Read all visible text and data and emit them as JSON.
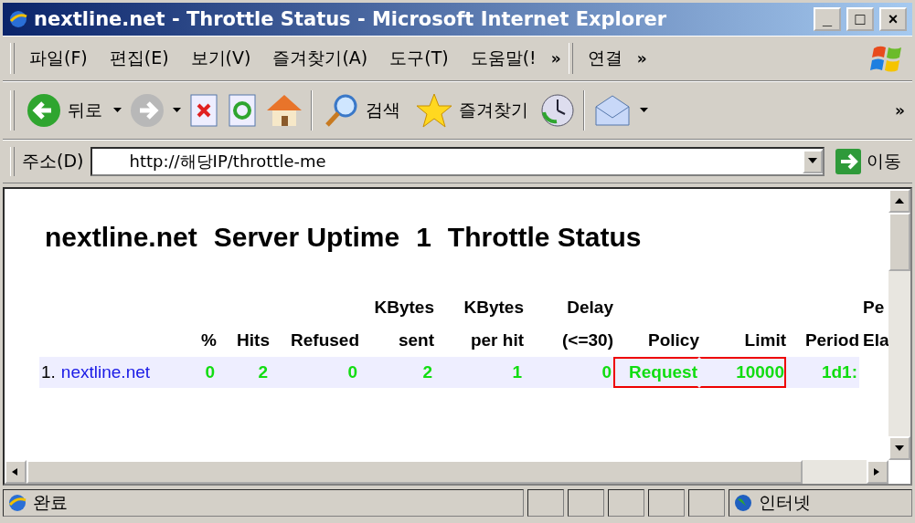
{
  "window": {
    "title": "nextline.net - Throttle Status - Microsoft Internet Explorer",
    "controls": [
      "_",
      "□",
      "×"
    ]
  },
  "menu": {
    "items": [
      "파일(F)",
      "편집(E)",
      "보기(V)",
      "즐겨찾기(A)",
      "도구(T)",
      "도움말(!"
    ],
    "chevron": "»",
    "links": "연결",
    "links_chevron": "»"
  },
  "toolbar": {
    "back": "뒤로",
    "search": "검색",
    "favorites": "즐겨찾기",
    "chevron": "»"
  },
  "address": {
    "label": "주소(D)",
    "value": "http://해당IP/throttle-me",
    "go": "이동"
  },
  "page": {
    "heading": [
      "nextline.net",
      "Server Uptime",
      "1",
      "Throttle Status"
    ],
    "table": {
      "header_rows": [
        [
          "",
          "",
          "",
          "",
          "KBytes",
          "KBytes",
          "Delay",
          "",
          "",
          "",
          "Pe"
        ],
        [
          "",
          "%",
          "Hits",
          "Refused",
          "sent",
          "per hit",
          "(<=30)",
          "Policy",
          "Limit",
          "Period",
          "Ela"
        ]
      ],
      "rows": [
        {
          "index": "1.",
          "cells": [
            {
              "kind": "link",
              "text": "nextline.net"
            },
            {
              "kind": "value",
              "text": "0"
            },
            {
              "kind": "value",
              "text": "2"
            },
            {
              "kind": "value",
              "text": "0"
            },
            {
              "kind": "value",
              "text": "2"
            },
            {
              "kind": "value",
              "text": "1"
            },
            {
              "kind": "value",
              "text": "0"
            },
            {
              "kind": "value",
              "text": "Request",
              "highlighted": true
            },
            {
              "kind": "value",
              "text": "10000",
              "highlighted": true
            },
            {
              "kind": "value",
              "text": "1d1:"
            }
          ]
        }
      ]
    }
  },
  "status_bar": {
    "text": "완료",
    "zone": "인터넷"
  }
}
